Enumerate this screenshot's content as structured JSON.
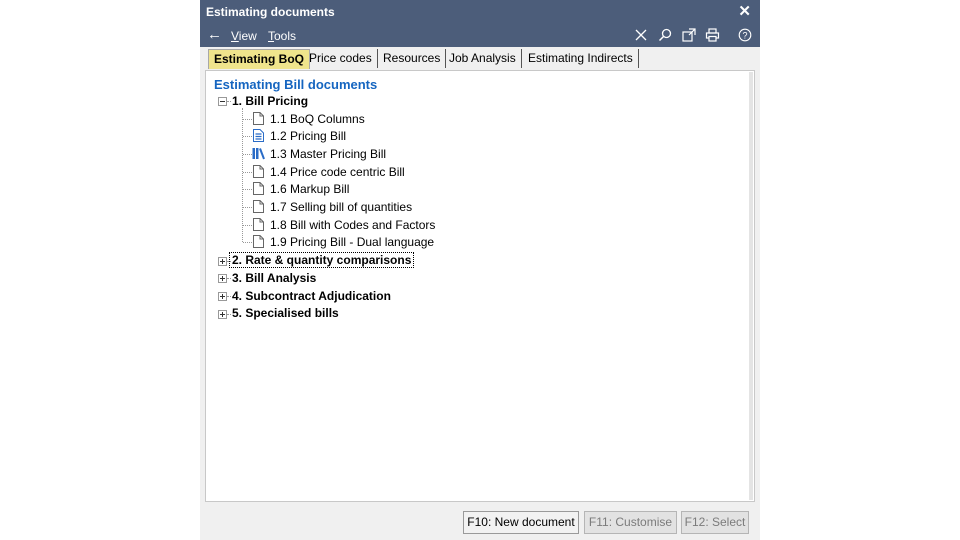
{
  "window": {
    "title": "Estimating documents"
  },
  "menu": {
    "view_prefix": "",
    "view_accel": "V",
    "view_rest": "iew",
    "tools_accel": "T",
    "tools_rest": "ools"
  },
  "tabs": [
    "Estimating BoQ",
    "Price codes",
    "Resources",
    "Job Analysis",
    "Estimating Indirects"
  ],
  "tree": {
    "heading": "Estimating Bill documents",
    "groups": [
      {
        "label": "1. Bill Pricing",
        "expanded": true,
        "children": [
          {
            "label": "1.1 BoQ Columns",
            "icon": "document-icon"
          },
          {
            "label": "1.2 Pricing Bill",
            "icon": "document-blue-icon"
          },
          {
            "label": "1.3 Master Pricing Bill",
            "icon": "library-icon"
          },
          {
            "label": "1.4 Price code centric Bill",
            "icon": "document-icon"
          },
          {
            "label": "1.6 Markup Bill",
            "icon": "document-icon"
          },
          {
            "label": "1.7 Selling bill of quantities",
            "icon": "document-icon"
          },
          {
            "label": "1.8 Bill with Codes and Factors",
            "icon": "document-icon"
          },
          {
            "label": "1.9 Pricing Bill - Dual language",
            "icon": "document-icon"
          }
        ]
      },
      {
        "label": "2. Rate & quantity comparisons",
        "expanded": false
      },
      {
        "label": "3. Bill Analysis",
        "expanded": false
      },
      {
        "label": "4. Subcontract Adjudication",
        "expanded": false
      },
      {
        "label": "5. Specialised bills",
        "expanded": false
      }
    ]
  },
  "footer": {
    "new_document": "F10: New document",
    "customise": "F11: Customise",
    "select": "F12: Select"
  },
  "colors": {
    "titlebar": "#4c5d7a",
    "active_tab": "#efe48c",
    "heading": "#1565c0"
  }
}
